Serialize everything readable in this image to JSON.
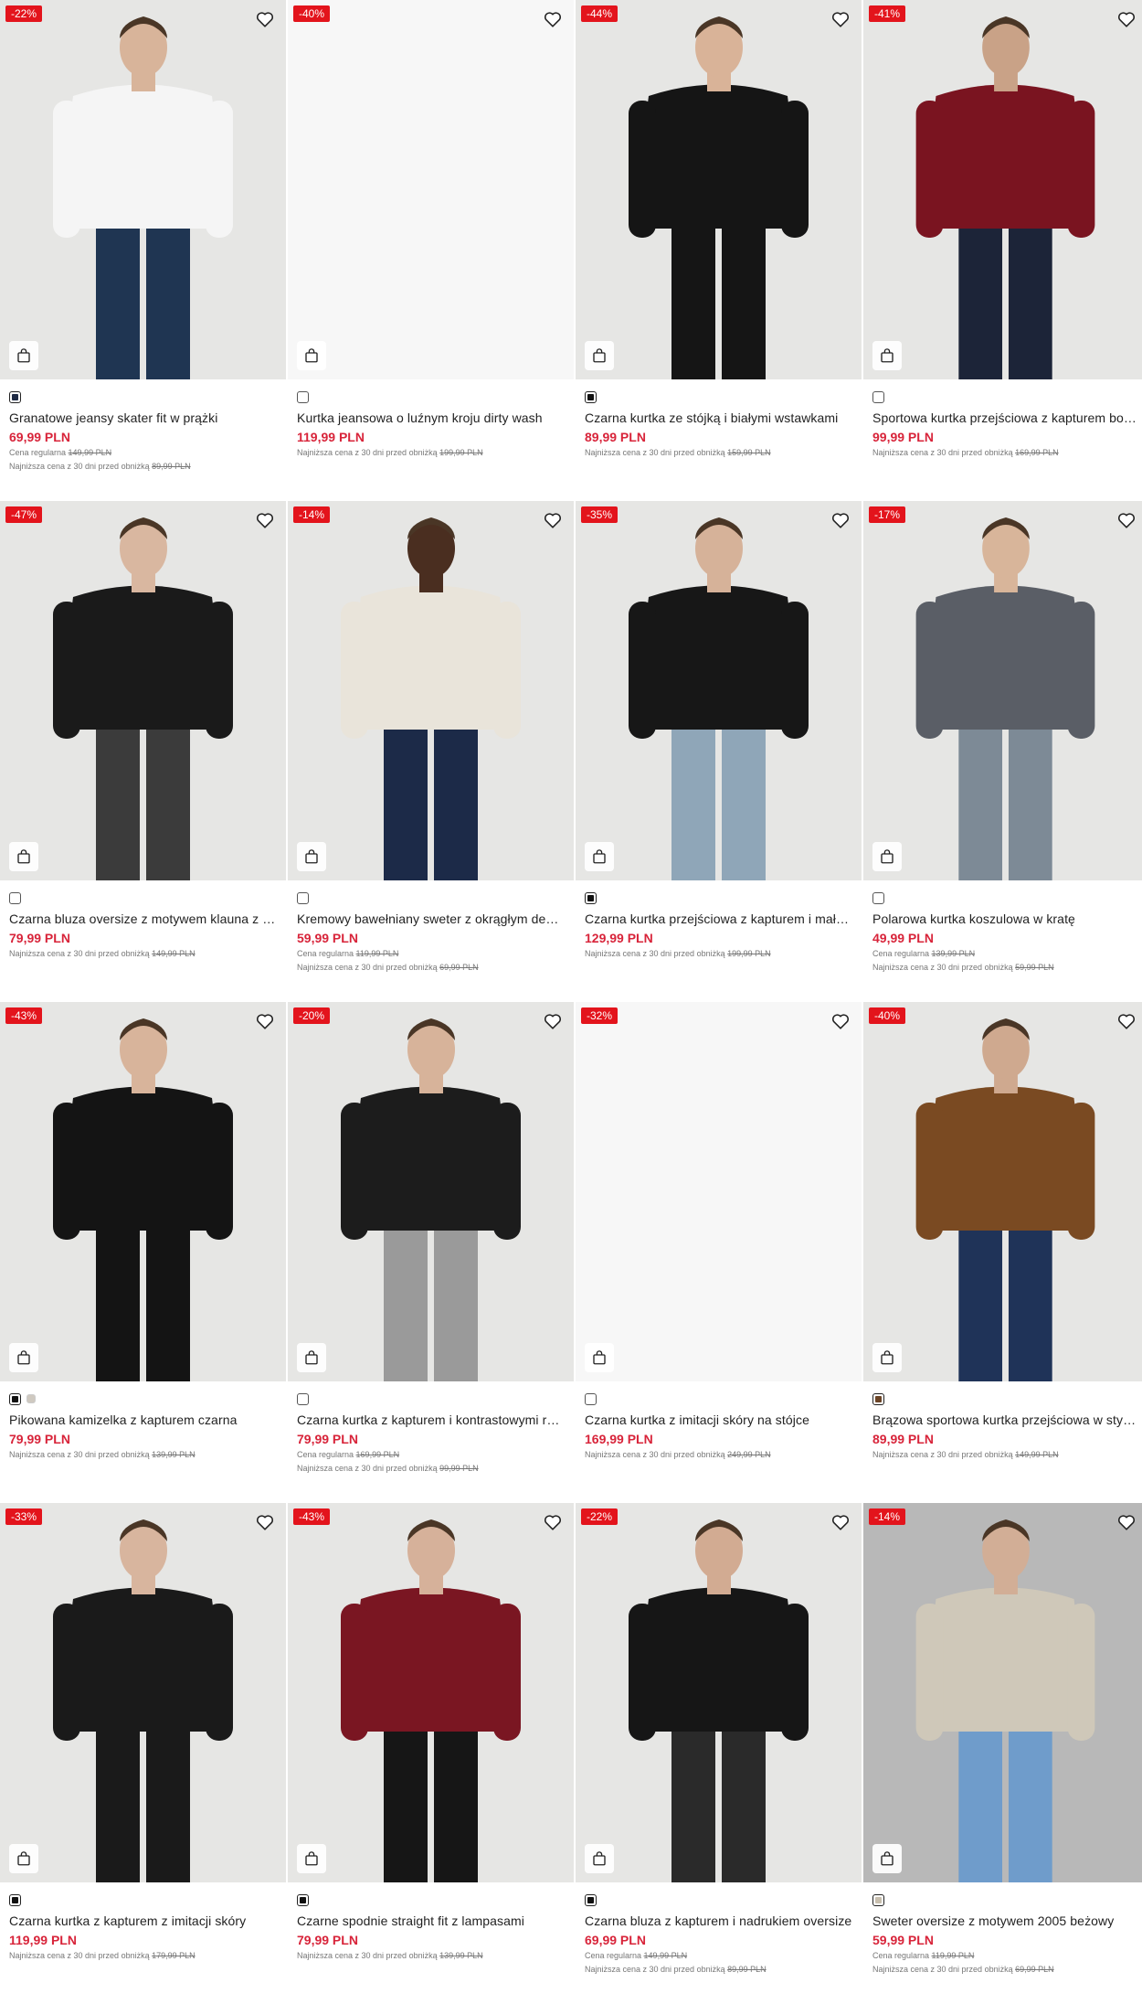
{
  "products": [
    {
      "badge": "-22%",
      "name": "Granatowe jeansy skater fit w prążki",
      "price": "69,99 PLN",
      "lines": [
        {
          "label": "Cena regularna",
          "value": "149,99 PLN"
        },
        {
          "label": "Najniższa cena z 30 dni przed obniżką",
          "value": "89,99 PLN"
        }
      ],
      "swatches": [
        "#1e2a44"
      ],
      "selected": true,
      "bg": "photo",
      "top": "#f5f5f5",
      "bottom": "#1f3552",
      "skin": "#d8b49a"
    },
    {
      "badge": "-40%",
      "name": "Kurtka jeansowa o luźnym kroju dirty wash",
      "price": "119,99 PLN",
      "lines": [
        {
          "label": "Najniższa cena z 30 dni przed obniżką",
          "value": "199,99 PLN"
        }
      ],
      "swatches": [
        "#ffffff"
      ],
      "selected": false,
      "bg": "white"
    },
    {
      "badge": "-44%",
      "name": "Czarna kurtka ze stójką i białymi wstawkami",
      "price": "89,99 PLN",
      "lines": [
        {
          "label": "Najniższa cena z 30 dni przed obniżką",
          "value": "159,99 PLN"
        }
      ],
      "swatches": [
        "#111111"
      ],
      "selected": true,
      "bg": "photo",
      "top": "#151515",
      "bottom": "#151515",
      "skin": "#d9b398"
    },
    {
      "badge": "-41%",
      "name": "Sportowa kurtka przejściowa z kapturem bordowa",
      "price": "99,99 PLN",
      "lines": [
        {
          "label": "Najniższa cena z 30 dni przed obniżką",
          "value": "169,99 PLN"
        }
      ],
      "swatches": [
        "#ffffff"
      ],
      "selected": false,
      "bg": "photo",
      "top": "#7a1420",
      "bottom": "#1c2438",
      "skin": "#c9a287"
    },
    {
      "badge": "-47%",
      "name": "Czarna bluza oversize z motywem klauna z dżetami",
      "price": "79,99 PLN",
      "lines": [
        {
          "label": "Najniższa cena z 30 dni przed obniżką",
          "value": "149,99 PLN"
        }
      ],
      "swatches": [
        "#ffffff"
      ],
      "selected": false,
      "bg": "photo",
      "top": "#1a1a1a",
      "bottom": "#3b3b3b",
      "skin": "#d9b7a0"
    },
    {
      "badge": "-14%",
      "name": "Kremowy bawełniany sweter z okrągłym dekoltem",
      "price": "59,99 PLN",
      "lines": [
        {
          "label": "Cena regularna",
          "value": "119,99 PLN"
        },
        {
          "label": "Najniższa cena z 30 dni przed obniżką",
          "value": "69,99 PLN"
        }
      ],
      "swatches": [
        "#ffffff"
      ],
      "selected": false,
      "bg": "photo",
      "top": "#e9e4da",
      "bottom": "#1c2a48",
      "skin": "#4a2e20"
    },
    {
      "badge": "-35%",
      "name": "Czarna kurtka przejściowa z kapturem i małym logo",
      "price": "129,99 PLN",
      "lines": [
        {
          "label": "Najniższa cena z 30 dni przed obniżką",
          "value": "199,99 PLN"
        }
      ],
      "swatches": [
        "#111111"
      ],
      "selected": true,
      "bg": "photo",
      "top": "#171717",
      "bottom": "#8fa6b8",
      "skin": "#d6b299"
    },
    {
      "badge": "-17%",
      "name": "Polarowa kurtka koszulowa w kratę",
      "price": "49,99 PLN",
      "lines": [
        {
          "label": "Cena regularna",
          "value": "139,99 PLN"
        },
        {
          "label": "Najniższa cena z 30 dni przed obniżką",
          "value": "59,99 PLN"
        }
      ],
      "swatches": [
        "#ffffff"
      ],
      "selected": false,
      "bg": "photo",
      "top": "#5a5e66",
      "bottom": "#7d8a96",
      "skin": "#d8b59a"
    },
    {
      "badge": "-43%",
      "name": "Pikowana kamizelka z kapturem czarna",
      "price": "79,99 PLN",
      "lines": [
        {
          "label": "Najniższa cena z 30 dni przed obniżką",
          "value": "139,99 PLN"
        }
      ],
      "swatches": [
        "#111111",
        "#cfc9c0"
      ],
      "selected": true,
      "bg": "photo",
      "top": "#141414",
      "bottom": "#141414",
      "skin": "#d8b49b"
    },
    {
      "badge": "-20%",
      "name": "Czarna kurtka z kapturem i kontrastowymi rękawami",
      "price": "79,99 PLN",
      "lines": [
        {
          "label": "Cena regularna",
          "value": "169,99 PLN"
        },
        {
          "label": "Najniższa cena z 30 dni przed obniżką",
          "value": "99,99 PLN"
        }
      ],
      "swatches": [
        "#ffffff"
      ],
      "selected": false,
      "bg": "photo",
      "top": "#1c1c1c",
      "bottom": "#9a9a9a",
      "skin": "#d7b39a"
    },
    {
      "badge": "-32%",
      "name": "Czarna kurtka z imitacji skóry na stójce",
      "price": "169,99 PLN",
      "lines": [
        {
          "label": "Najniższa cena z 30 dni przed obniżką",
          "value": "249,99 PLN"
        }
      ],
      "swatches": [
        "#ffffff"
      ],
      "selected": false,
      "bg": "white"
    },
    {
      "badge": "-40%",
      "name": "Brązowa sportowa kurtka przejściowa w stylu retro",
      "price": "89,99 PLN",
      "lines": [
        {
          "label": "Najniższa cena z 30 dni przed obniżką",
          "value": "149,99 PLN"
        }
      ],
      "swatches": [
        "#6b4426"
      ],
      "selected": true,
      "bg": "photo",
      "top": "#7a4a22",
      "bottom": "#1f3358",
      "skin": "#cfa98f"
    },
    {
      "badge": "-33%",
      "name": "Czarna kurtka z kapturem z imitacji skóry",
      "price": "119,99 PLN",
      "lines": [
        {
          "label": "Najniższa cena z 30 dni przed obniżką",
          "value": "179,99 PLN"
        }
      ],
      "swatches": [
        "#111111"
      ],
      "selected": true,
      "bg": "photo",
      "top": "#1a1a1a",
      "bottom": "#1a1a1a",
      "skin": "#d8b59e"
    },
    {
      "badge": "-43%",
      "name": "Czarne spodnie straight fit z lampasami",
      "price": "79,99 PLN",
      "lines": [
        {
          "label": "Najniższa cena z 30 dni przed obniżką",
          "value": "139,99 PLN"
        }
      ],
      "swatches": [
        "#111111"
      ],
      "selected": true,
      "bg": "photo",
      "top": "#7a1622",
      "bottom": "#161616",
      "skin": "#d6b19a"
    },
    {
      "badge": "-22%",
      "name": "Czarna bluza z kapturem i nadrukiem oversize",
      "price": "69,99 PLN",
      "lines": [
        {
          "label": "Cena regularna",
          "value": "149,99 PLN"
        },
        {
          "label": "Najniższa cena z 30 dni przed obniżką",
          "value": "89,99 PLN"
        }
      ],
      "swatches": [
        "#111111"
      ],
      "selected": true,
      "bg": "photo",
      "top": "#161616",
      "bottom": "#2a2a2a",
      "skin": "#d2ab92"
    },
    {
      "badge": "-14%",
      "name": "Sweter oversize z motywem 2005 beżowy",
      "price": "59,99 PLN",
      "lines": [
        {
          "label": "Cena regularna",
          "value": "119,99 PLN"
        },
        {
          "label": "Najniższa cena z 30 dni przed obniżką",
          "value": "69,99 PLN"
        }
      ],
      "swatches": [
        "#c8bfae"
      ],
      "selected": true,
      "bg": "grey",
      "top": "#cfc8b9",
      "bottom": "#6f9ccb",
      "skin": "#d2ae96"
    }
  ]
}
